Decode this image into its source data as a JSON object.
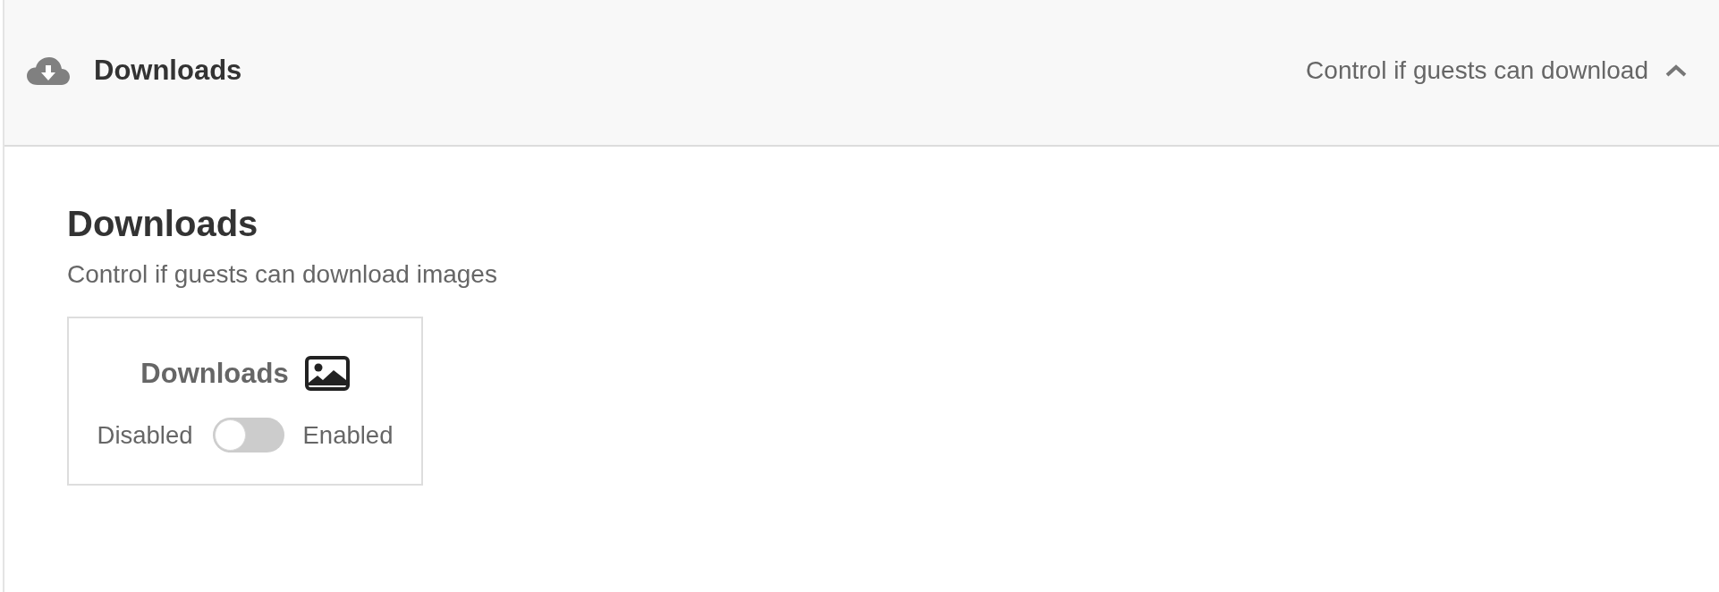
{
  "section": {
    "header": {
      "title": "Downloads",
      "summary": "Control if guests can download",
      "expanded": true
    },
    "heading": "Downloads",
    "description": "Control if guests can download images",
    "setting_card": {
      "title": "Downloads",
      "off_label": "Disabled",
      "on_label": "Enabled",
      "on": false
    }
  }
}
